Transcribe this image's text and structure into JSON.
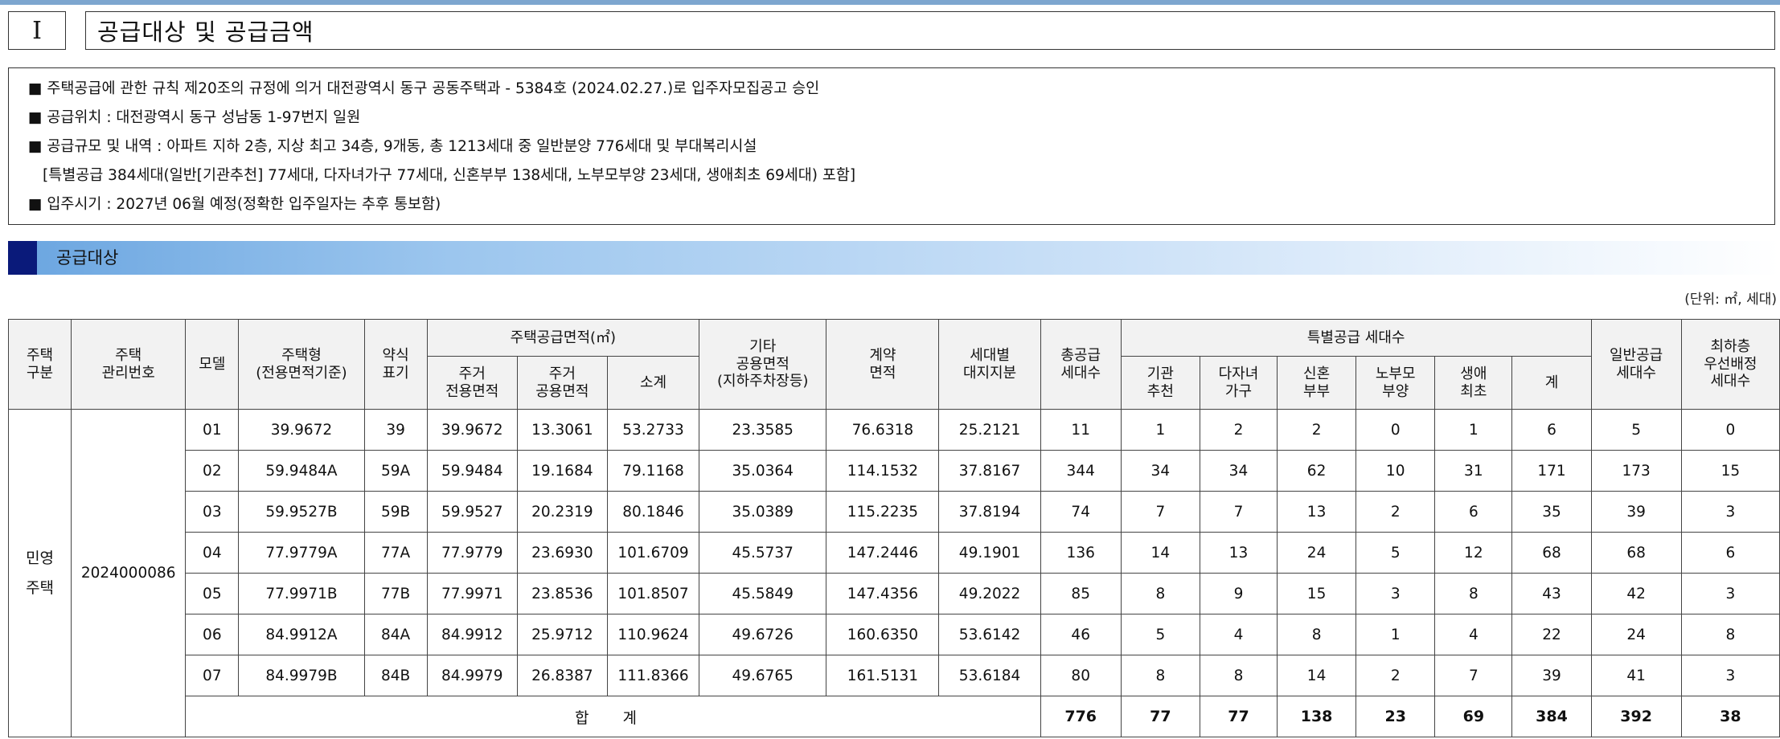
{
  "title_row": {
    "roman": "Ⅰ",
    "title": "공급대상 및 공급금액"
  },
  "info": {
    "line1": "■ 주택공급에 관한 규칙 제20조의 규정에 의거 대전광역시 동구 공동주택과 - 5384호 (2024.02.27.)로 입주자모집공고 승인",
    "line2": "■ 공급위치 : 대전광역시 동구 성남동 1-97번지 일원",
    "line3": "■ 공급규모 및 내역 : 아파트 지하 2층, 지상 최고 34층, 9개동, 총 1213세대 중 일반분양 776세대 및 부대복리시설",
    "line4": "[특별공급 384세대(일반[기관추천] 77세대, 다자녀가구 77세대, 신혼부부 138세대, 노부모부양 23세대, 생애최초 69세대) 포함]",
    "line5": "■ 입주시기 : 2027년 06월 예정(정확한 입주일자는 추후 통보함)"
  },
  "section": {
    "label": "공급대상"
  },
  "unit_note": "(단위: ㎡, 세대)",
  "table": {
    "headers": {
      "house_class": [
        "주택",
        "구분"
      ],
      "mgmt_no": [
        "주택",
        "관리번호"
      ],
      "model": "모델",
      "house_type": [
        "주택형",
        "(전용면적기준)"
      ],
      "abbr": [
        "약식",
        "표기"
      ],
      "supply_area": "주택공급면적(㎡)",
      "exclusive_area": [
        "주거",
        "전용면적"
      ],
      "common_area": [
        "주거",
        "공용면적"
      ],
      "subtotal": "소계",
      "other_common": [
        "기타",
        "공용면적",
        "(지하주차장등)"
      ],
      "contract_area": [
        "계약",
        "면적"
      ],
      "land_share": [
        "세대별",
        "대지지분"
      ],
      "total_supply": [
        "총공급",
        "세대수"
      ],
      "special_supply": "특별공급 세대수",
      "institution": [
        "기관",
        "추천"
      ],
      "multi_child": [
        "다자녀",
        "가구"
      ],
      "newlywed": [
        "신혼",
        "부부"
      ],
      "elderly": [
        "노부모",
        "부양"
      ],
      "first_life": [
        "생애",
        "최초"
      ],
      "special_sum": "계",
      "general_supply": [
        "일반공급",
        "세대수"
      ],
      "lowest_floor": [
        "최하층",
        "우선배정",
        "세대수"
      ]
    },
    "house_class_value": [
      "민영",
      "주택"
    ],
    "mgmt_no_value": "2024000086",
    "rows": [
      [
        "01",
        "39.9672",
        "39",
        "39.9672",
        "13.3061",
        "53.2733",
        "23.3585",
        "76.6318",
        "25.2121",
        "11",
        "1",
        "2",
        "2",
        "0",
        "1",
        "6",
        "5",
        "0"
      ],
      [
        "02",
        "59.9484A",
        "59A",
        "59.9484",
        "19.1684",
        "79.1168",
        "35.0364",
        "114.1532",
        "37.8167",
        "344",
        "34",
        "34",
        "62",
        "10",
        "31",
        "171",
        "173",
        "15"
      ],
      [
        "03",
        "59.9527B",
        "59B",
        "59.9527",
        "20.2319",
        "80.1846",
        "35.0389",
        "115.2235",
        "37.8194",
        "74",
        "7",
        "7",
        "13",
        "2",
        "6",
        "35",
        "39",
        "3"
      ],
      [
        "04",
        "77.9779A",
        "77A",
        "77.9779",
        "23.6930",
        "101.6709",
        "45.5737",
        "147.2446",
        "49.1901",
        "136",
        "14",
        "13",
        "24",
        "5",
        "12",
        "68",
        "68",
        "6"
      ],
      [
        "05",
        "77.9971B",
        "77B",
        "77.9971",
        "23.8536",
        "101.8507",
        "45.5849",
        "147.4356",
        "49.2022",
        "85",
        "8",
        "9",
        "15",
        "3",
        "8",
        "43",
        "42",
        "3"
      ],
      [
        "06",
        "84.9912A",
        "84A",
        "84.9912",
        "25.9712",
        "110.9624",
        "49.6726",
        "160.6350",
        "53.6142",
        "46",
        "5",
        "4",
        "8",
        "1",
        "4",
        "22",
        "24",
        "8"
      ],
      [
        "07",
        "84.9979B",
        "84B",
        "84.9979",
        "26.8387",
        "111.8366",
        "49.6765",
        "161.5131",
        "53.6184",
        "80",
        "8",
        "8",
        "14",
        "2",
        "7",
        "39",
        "41",
        "3"
      ]
    ],
    "total": {
      "label": "합 계",
      "values": [
        "776",
        "77",
        "77",
        "138",
        "23",
        "69",
        "384",
        "392",
        "38"
      ]
    }
  }
}
